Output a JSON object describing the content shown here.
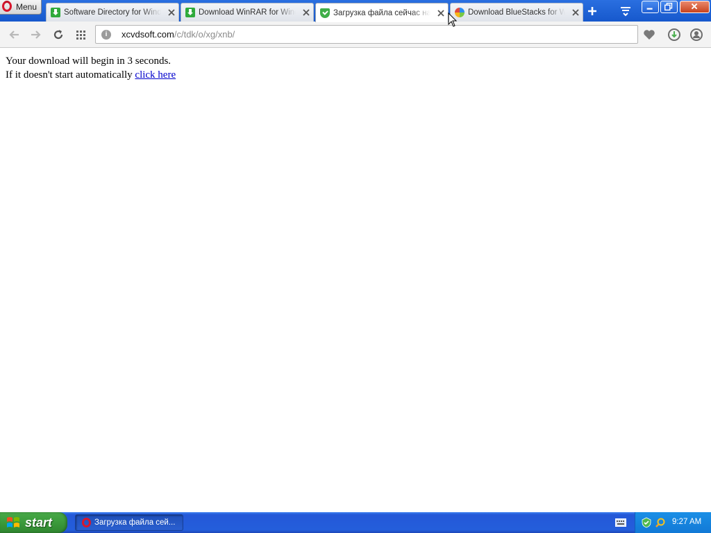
{
  "browser": {
    "menu_label": "Menu",
    "tabs": [
      {
        "title": "Software Directory for Windows",
        "favicon": "download-favicon",
        "active": false
      },
      {
        "title": "Download WinRAR for Windows",
        "favicon": "download-favicon",
        "active": false
      },
      {
        "title": "Загрузка файла сейчас начнется",
        "favicon": "shield-favicon",
        "active": true
      },
      {
        "title": "Download BlueStacks for Windows",
        "favicon": "bluestacks-favicon",
        "active": false
      }
    ],
    "address": {
      "host": "xcvdsoft.com",
      "path": "/c/tdk/o/xg/xnb/",
      "full": "xcvdsoft.com/c/tdk/o/xg/xnb/"
    }
  },
  "page": {
    "line1": "Your download will begin in 3 seconds.",
    "line2_prefix": "If it doesn't start automatically ",
    "link_text": "click here"
  },
  "taskbar": {
    "start_label": "start",
    "task_title": "Загрузка файла сей...",
    "clock": "9:27 AM"
  },
  "colors": {
    "tabstrip": "#1658cc",
    "link": "#0000cc",
    "start_green": "#3c9c3c",
    "taskbar_blue": "#245edb"
  }
}
